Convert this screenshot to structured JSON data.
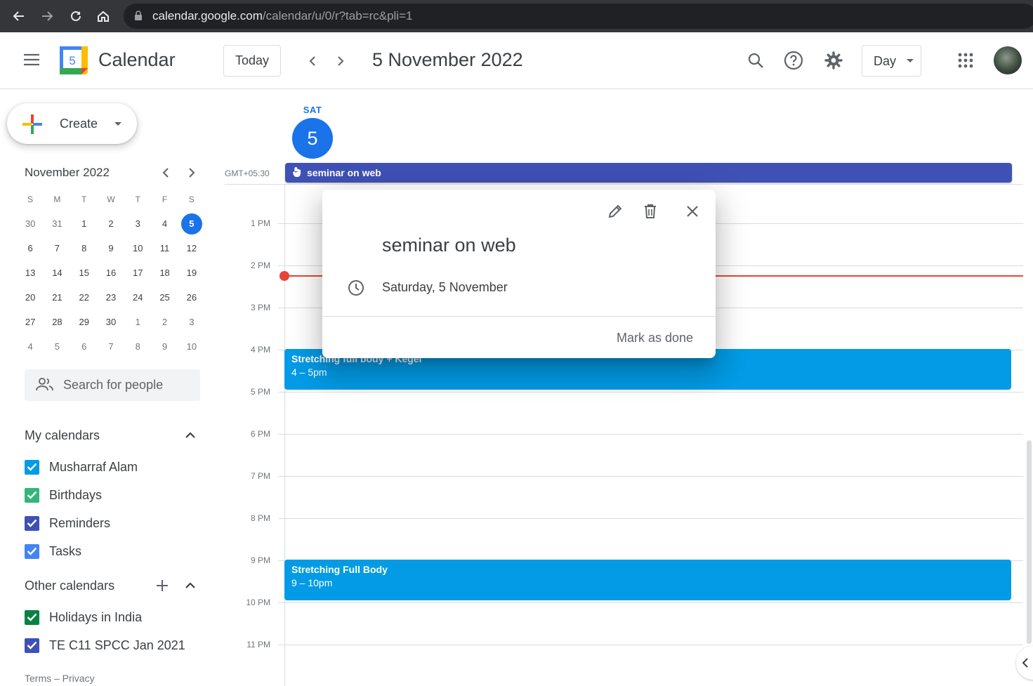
{
  "browser": {
    "url_host": "calendar.google.com",
    "url_path": "/calendar/u/0/r?tab=rc&pli=1"
  },
  "header": {
    "logo_number": "5",
    "app_title": "Calendar",
    "today_label": "Today",
    "date_title": "5 November 2022",
    "view_label": "Day"
  },
  "sidebar": {
    "create_label": "Create",
    "mini_calendar": {
      "title": "November 2022",
      "weekdays": [
        "S",
        "M",
        "T",
        "W",
        "T",
        "F",
        "S"
      ],
      "weeks": [
        [
          "30",
          "31",
          "1",
          "2",
          "3",
          "4",
          "5"
        ],
        [
          "6",
          "7",
          "8",
          "9",
          "10",
          "11",
          "12"
        ],
        [
          "13",
          "14",
          "15",
          "16",
          "17",
          "18",
          "19"
        ],
        [
          "20",
          "21",
          "22",
          "23",
          "24",
          "25",
          "26"
        ],
        [
          "27",
          "28",
          "29",
          "30",
          "1",
          "2",
          "3"
        ],
        [
          "4",
          "5",
          "6",
          "7",
          "8",
          "9",
          "10"
        ]
      ],
      "selected": "5"
    },
    "search_people_placeholder": "Search for people",
    "my_calendars_title": "My calendars",
    "my_calendars": [
      {
        "label": "Musharraf Alam",
        "color": "#039be5"
      },
      {
        "label": "Birthdays",
        "color": "#33b679"
      },
      {
        "label": "Reminders",
        "color": "#3f51b5"
      },
      {
        "label": "Tasks",
        "color": "#4285f4"
      }
    ],
    "other_calendars_title": "Other calendars",
    "other_calendars": [
      {
        "label": "Holidays in India",
        "color": "#0b8043"
      },
      {
        "label": "TE C11 SPCC Jan 2021",
        "color": "#3f51b5"
      }
    ],
    "footer": "Terms – Privacy"
  },
  "day_view": {
    "day_name": "SAT",
    "day_number": "5",
    "timezone": "GMT+05:30",
    "allday_event": "seminar on web",
    "hours": [
      "1 PM",
      "2 PM",
      "3 PM",
      "4 PM",
      "5 PM",
      "6 PM",
      "7 PM",
      "8 PM",
      "9 PM",
      "10 PM",
      "11 PM"
    ],
    "events": [
      {
        "title": "Stretching full body + Kegel",
        "time": "4 – 5pm",
        "color": "#039be5"
      },
      {
        "title": "Stretching Full Body",
        "time": "9 – 10pm",
        "color": "#039be5"
      }
    ]
  },
  "popover": {
    "title": "seminar on web",
    "date": "Saturday, 5 November",
    "action": "Mark as done"
  },
  "colors": {
    "accent": "#1a73e8",
    "now_line": "#ea4335",
    "allday_event": "#3f51b5"
  }
}
